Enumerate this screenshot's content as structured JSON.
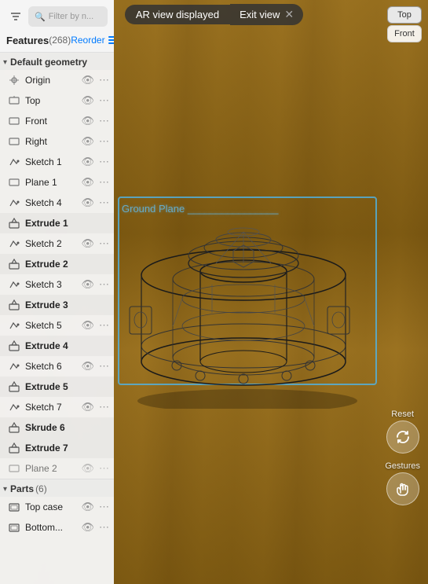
{
  "topBar": {
    "arViewLabel": "AR view displayed",
    "exitViewLabel": "Exit view",
    "closeSymbol": "✕"
  },
  "viewControls": {
    "topBtn": "Top",
    "frontBtn": "Front"
  },
  "panel": {
    "filterPlaceholder": "Filter by n...",
    "featuresLabel": "Features",
    "featuresCount": "(268)",
    "reorderLabel": "Reorder"
  },
  "defaultGeometry": {
    "sectionLabel": "Default geometry",
    "items": [
      {
        "label": "Origin",
        "type": "origin"
      },
      {
        "label": "Top",
        "type": "plane"
      },
      {
        "label": "Front",
        "type": "plane"
      },
      {
        "label": "Right",
        "type": "plane"
      },
      {
        "label": "Sketch 1",
        "type": "sketch"
      },
      {
        "label": "Plane 1",
        "type": "plane"
      },
      {
        "label": "Sketch 4",
        "type": "sketch"
      },
      {
        "label": "Extrude 1",
        "type": "extrude"
      },
      {
        "label": "Sketch 2",
        "type": "sketch"
      },
      {
        "label": "Extrude 2",
        "type": "extrude"
      },
      {
        "label": "Sketch 3",
        "type": "sketch"
      },
      {
        "label": "Extrude 3",
        "type": "extrude"
      },
      {
        "label": "Sketch 5",
        "type": "sketch"
      },
      {
        "label": "Extrude 4",
        "type": "extrude"
      },
      {
        "label": "Sketch 6",
        "type": "sketch"
      },
      {
        "label": "Extrude 5",
        "type": "extrude"
      },
      {
        "label": "Sketch 7",
        "type": "sketch"
      },
      {
        "label": "Skrude 6",
        "type": "extrude"
      },
      {
        "label": "Extrude 7",
        "type": "extrude"
      },
      {
        "label": "Plane 2",
        "type": "plane"
      }
    ]
  },
  "parts": {
    "sectionLabel": "Parts",
    "count": "(6)",
    "items": [
      {
        "label": "Top case",
        "type": "part"
      },
      {
        "label": "Bottom...",
        "type": "part"
      }
    ]
  },
  "arScene": {
    "groundLabel": "Ground Plane  ________________",
    "resetLabel": "Reset",
    "gesturesLabel": "Gestures"
  }
}
